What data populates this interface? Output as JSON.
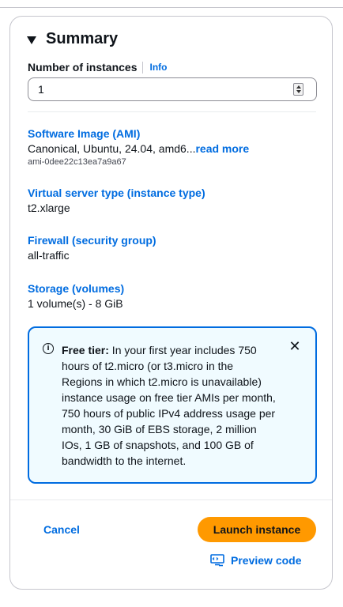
{
  "summary": {
    "title": "Summary",
    "instances_label": "Number of instances",
    "info_label": "Info",
    "instances_value": "1",
    "software_image": {
      "label": "Software Image (AMI)",
      "value": "Canonical, Ubuntu, 24.04, amd6...",
      "read_more": "read more",
      "ami_id": "ami-0dee22c13ea7a9a67"
    },
    "instance_type": {
      "label": "Virtual server type (instance type)",
      "value": "t2.xlarge"
    },
    "firewall": {
      "label": "Firewall (security group)",
      "value": "all-traffic"
    },
    "storage": {
      "label": "Storage (volumes)",
      "value": "1 volume(s) - 8 GiB"
    },
    "free_tier": {
      "title": "Free tier:",
      "body": " In your first year includes 750 hours of t2.micro (or t3.micro in the Regions in which t2.micro is unavailable) instance usage on free tier AMIs per month, 750 hours of public IPv4 address usage per month, 30 GiB of EBS storage, 2 million IOs, 1 GB of snapshots, and 100 GB of bandwidth to the internet."
    },
    "cancel_label": "Cancel",
    "launch_label": "Launch instance",
    "preview_label": "Preview code"
  },
  "colors": {
    "link": "#006ce0",
    "primary_button": "#ff9900",
    "info_border": "#006ce0",
    "info_background": "#f0fbff"
  },
  "icons": [
    "caret-down-icon",
    "info-circle-icon",
    "close-icon",
    "code-preview-icon"
  ]
}
